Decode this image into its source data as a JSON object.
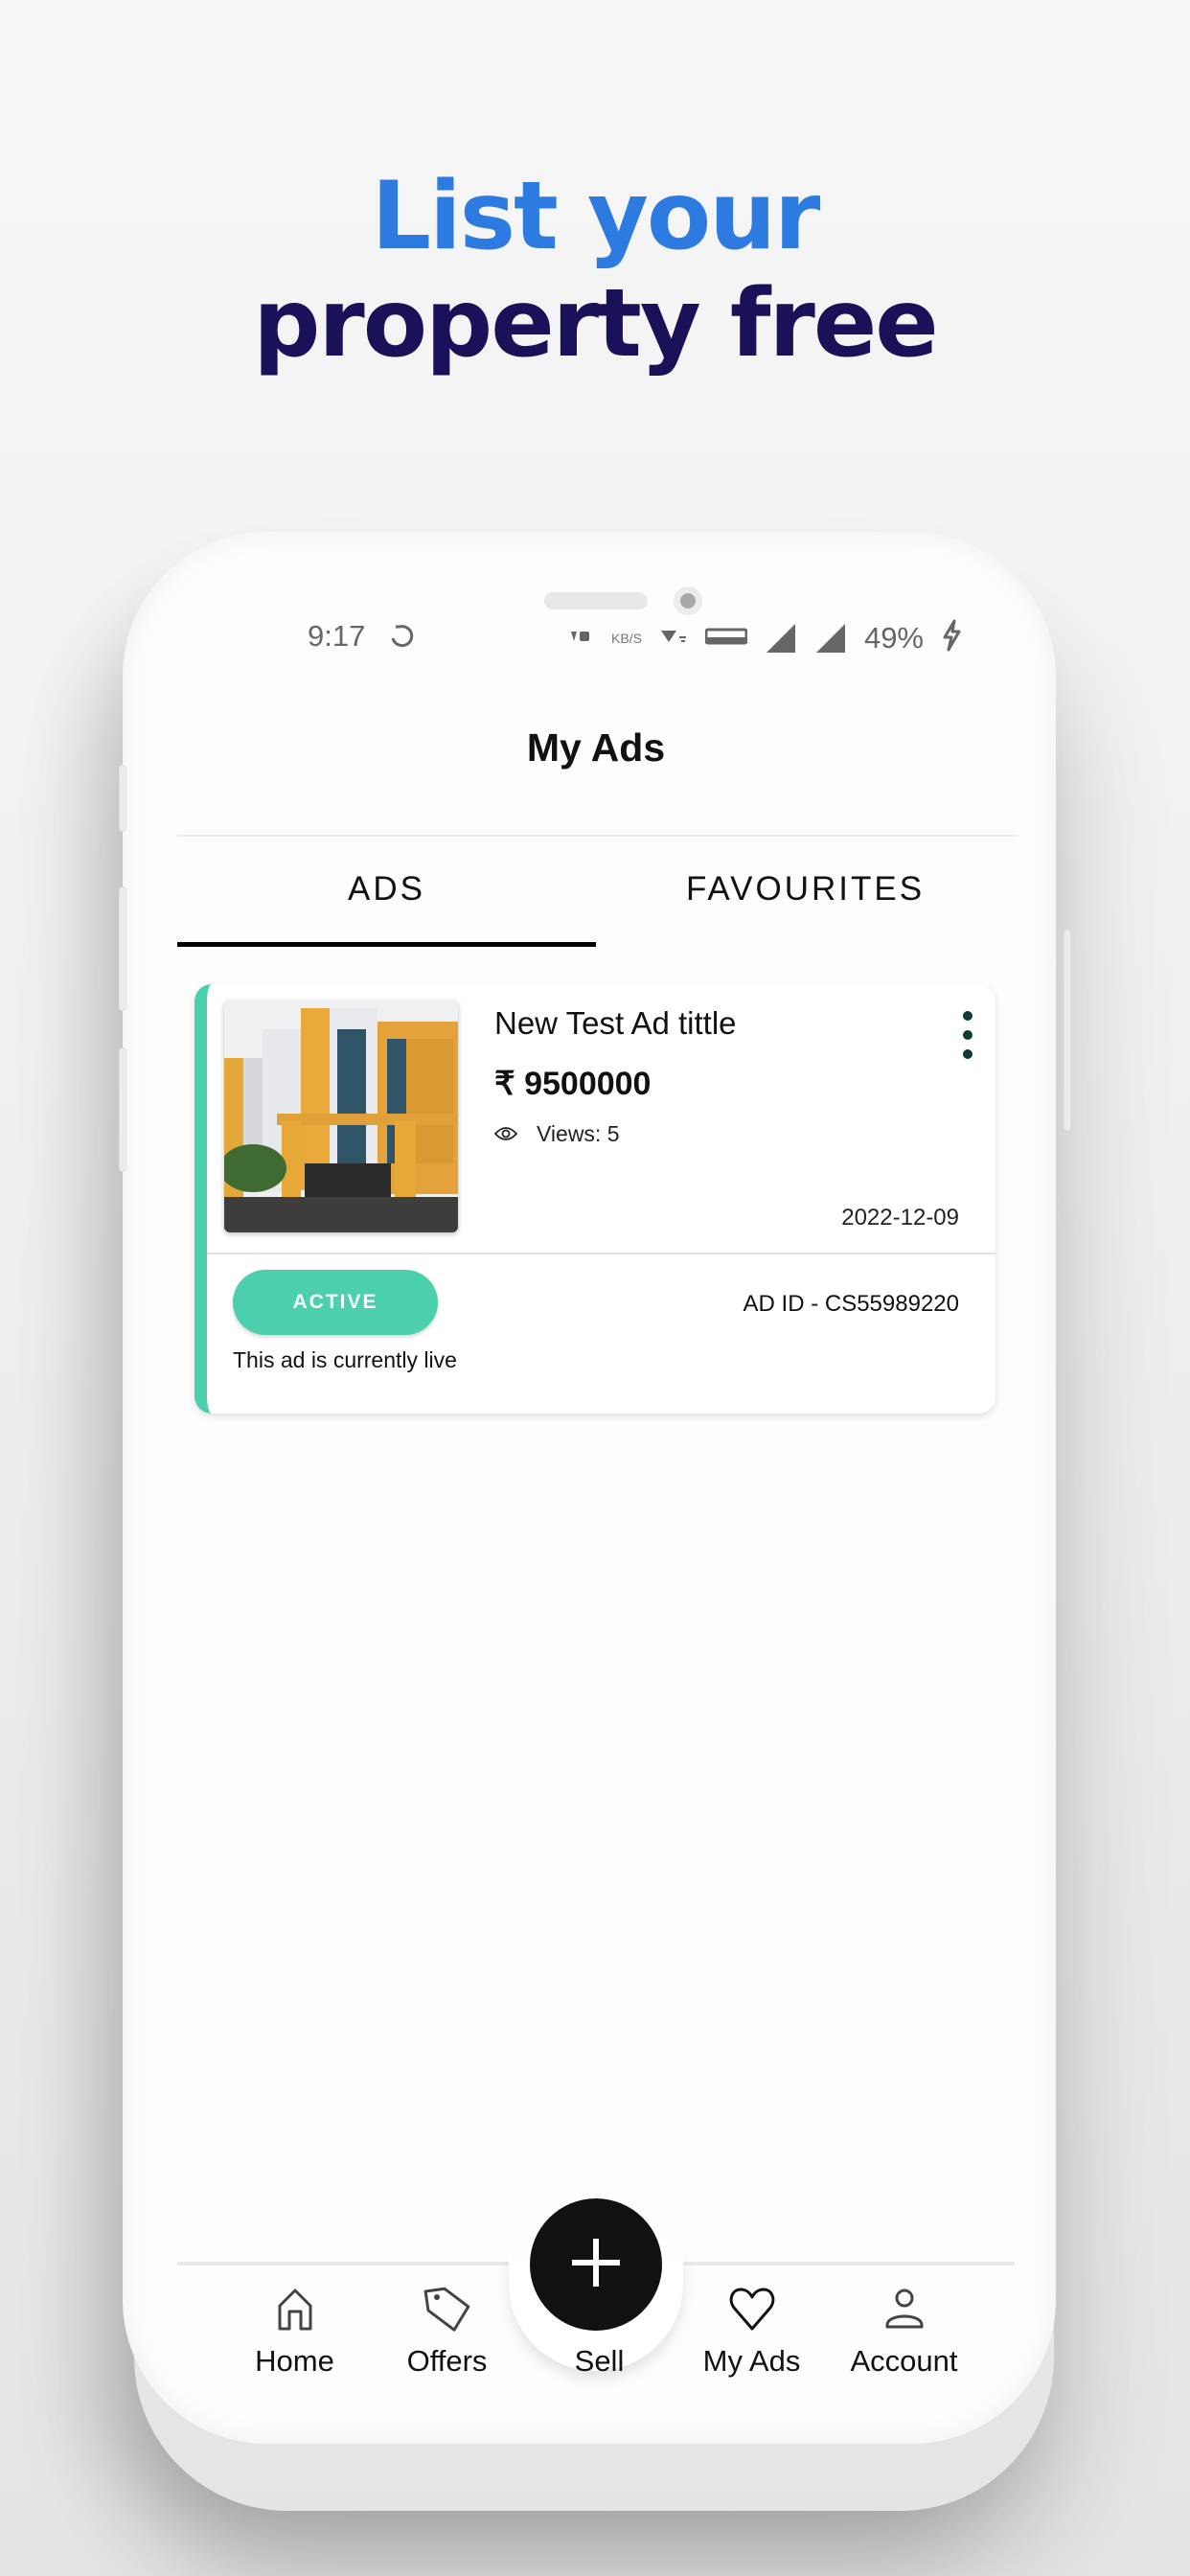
{
  "promo": {
    "line1": "List your",
    "line2": "property free",
    "line1_color": "#2d7be0",
    "line2_color": "#1a1258"
  },
  "status_bar": {
    "time": "9:17",
    "sync_icon": "sync-icon",
    "data_rate_unit": "KB/S",
    "network_badge": "LTE2",
    "battery": "49%",
    "charging_icon": "bolt-icon"
  },
  "header": {
    "title": "My Ads"
  },
  "tabs": [
    {
      "label": "ADS",
      "active": true
    },
    {
      "label": "FAVOURITES",
      "active": false
    }
  ],
  "ads": [
    {
      "title": "New Test Ad tittle",
      "currency_symbol": "₹",
      "price": "9500000",
      "views_label": "Views: 5",
      "date": "2022-12-09",
      "status": "ACTIVE",
      "status_text": "This ad is currently live",
      "ad_id": "AD ID - CS55989220",
      "image_alt": "Yellow and white apartment building",
      "accent_color": "#4ccfad"
    }
  ],
  "bottom_nav": {
    "items": [
      {
        "label": "Home",
        "icon": "home-icon"
      },
      {
        "label": "Offers",
        "icon": "tag-icon"
      },
      {
        "label": "Sell",
        "icon": "plus-icon"
      },
      {
        "label": "My Ads",
        "icon": "heart-icon"
      },
      {
        "label": "Account",
        "icon": "user-icon"
      }
    ]
  }
}
